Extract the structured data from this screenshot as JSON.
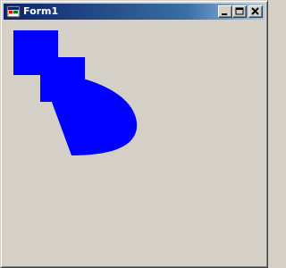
{
  "window": {
    "title": "Form1"
  },
  "icons": {
    "app": "form-app-icon",
    "minimize": "minimize-icon",
    "maximize": "maximize-icon",
    "close": "close-icon"
  },
  "colors": {
    "shape_fill": "#0000ff",
    "window_background": "#d4d0c8",
    "title_bar_start": "#0a246a",
    "title_bar_end": "#a6caf0",
    "title_text": "#ffffff"
  }
}
